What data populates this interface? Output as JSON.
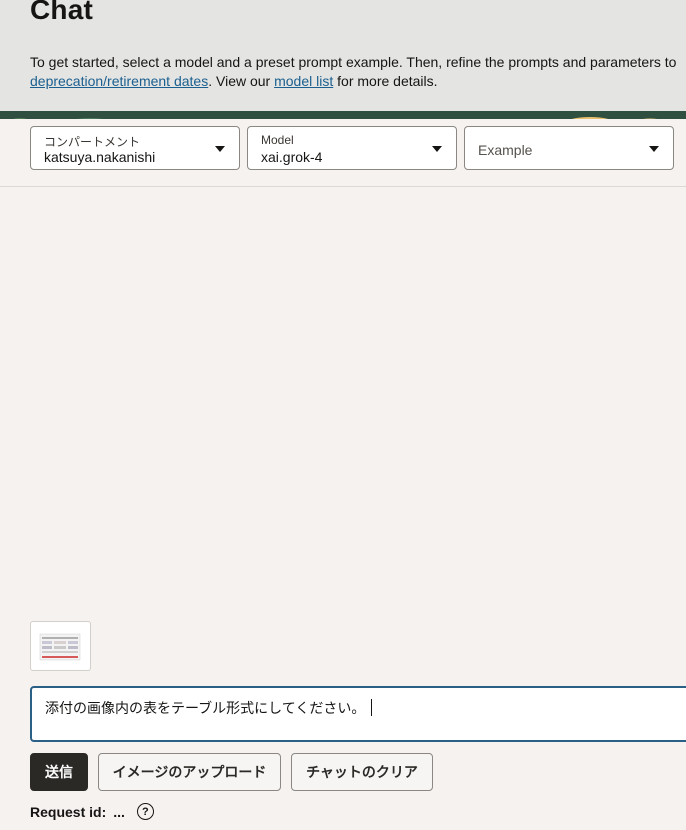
{
  "header": {
    "title": "Chat",
    "intro_line1": "To get started, select a model and a preset prompt example. Then, refine the prompts and parameters to",
    "link_deprecation": "deprecation/retirement dates",
    "text_view_our": ". View our ",
    "link_model_list": "model list",
    "text_more_details": " for more details."
  },
  "selectors": {
    "compartment": {
      "label": "コンパートメント",
      "value": "katsuya.nakanishi"
    },
    "model": {
      "label": "Model",
      "value": "xai.grok-4"
    },
    "example": {
      "placeholder": "Example"
    }
  },
  "prompt": {
    "value": "添付の画像内の表をテーブル形式にしてください。"
  },
  "buttons": {
    "send": "送信",
    "upload_image": "イメージのアップロード",
    "clear_chat": "チャットのクリア"
  },
  "request": {
    "label": "Request id:",
    "value": "..."
  },
  "icons": {
    "caret": "caret-down-icon",
    "help": "help-circle-icon"
  },
  "colors": {
    "link": "#1a5f8f",
    "primary_button": "#2b2926",
    "prompt_border": "#2a5f86"
  }
}
